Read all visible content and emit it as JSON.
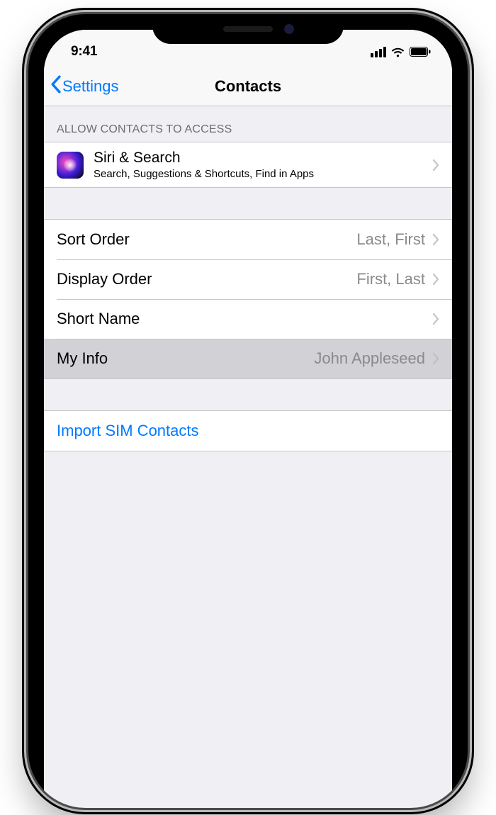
{
  "status": {
    "time": "9:41"
  },
  "nav": {
    "back_label": "Settings",
    "title": "Contacts"
  },
  "section_header": "Allow Contacts To Access",
  "siri": {
    "title": "Siri & Search",
    "subtitle": "Search, Suggestions & Shortcuts, Find in Apps"
  },
  "rows": {
    "sort_order": {
      "label": "Sort Order",
      "value": "Last, First"
    },
    "display_order": {
      "label": "Display Order",
      "value": "First, Last"
    },
    "short_name": {
      "label": "Short Name",
      "value": ""
    },
    "my_info": {
      "label": "My Info",
      "value": "John Appleseed"
    }
  },
  "import_label": "Import SIM Contacts"
}
